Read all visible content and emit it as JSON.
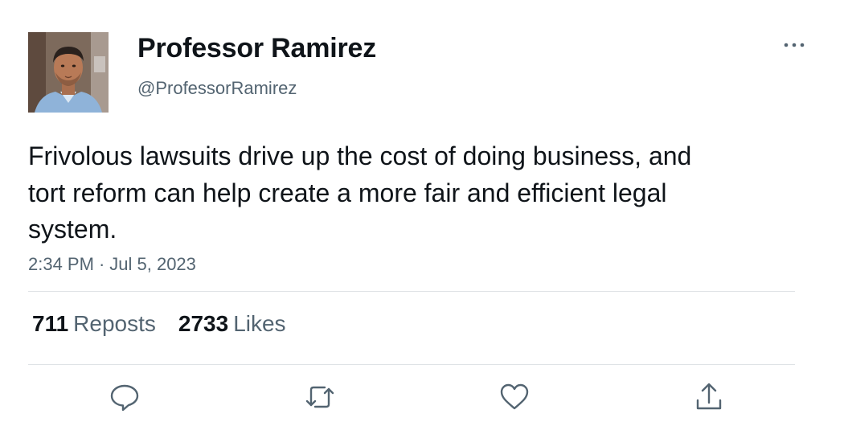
{
  "author": {
    "display_name": "Professor Ramirez",
    "handle": "@ProfessorRamirez"
  },
  "tweet": {
    "text": "Frivolous lawsuits drive up the cost of doing business, and tort reform can help create a more fair and efficient legal system.",
    "time": "2:34 PM",
    "separator": "·",
    "date": "Jul 5, 2023"
  },
  "stats": {
    "reposts_count": "711",
    "reposts_label": "Reposts",
    "likes_count": "2733",
    "likes_label": "Likes"
  },
  "icons": {
    "more": "more-horizontal-icon",
    "reply": "reply-icon",
    "repost": "repost-icon",
    "like": "heart-icon",
    "share": "share-icon"
  },
  "colors": {
    "text_primary": "#0f1419",
    "text_secondary": "#536471",
    "divider": "#dfe3e6"
  }
}
